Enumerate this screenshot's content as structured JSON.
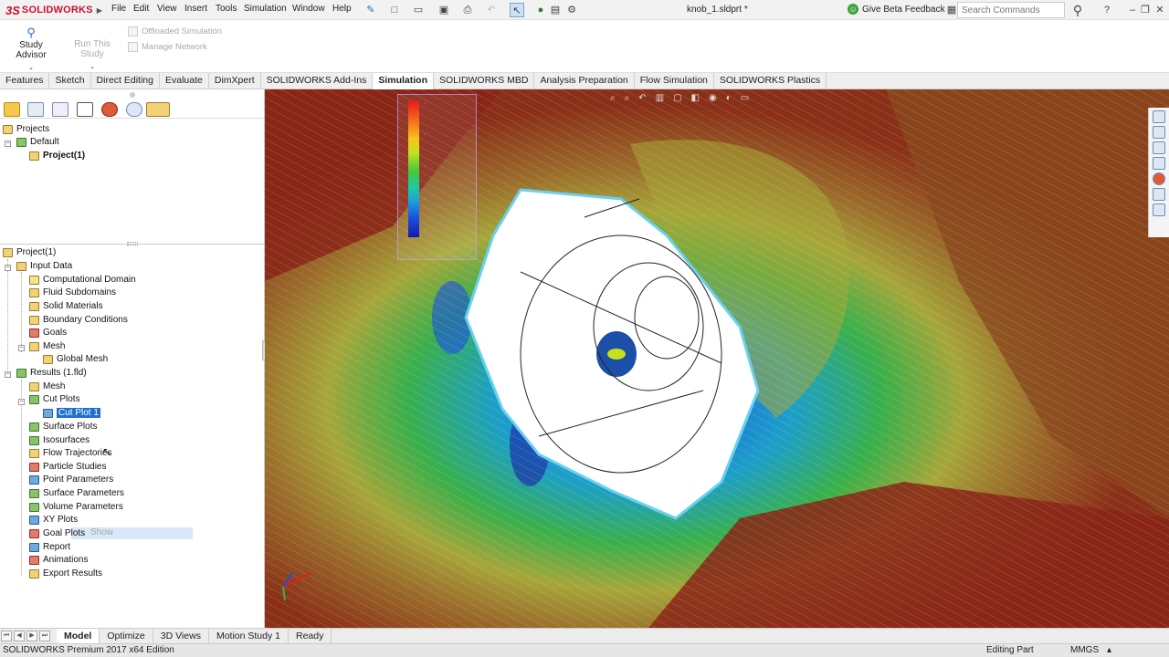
{
  "app": {
    "logo_ds": "3S",
    "logo_text": "SOLIDWORKS",
    "document_title": "knob_1.sldprt *",
    "feedback_label": "Give Beta Feedback",
    "search_placeholder": "Search Commands"
  },
  "menu": [
    "File",
    "Edit",
    "View",
    "Insert",
    "Tools",
    "Simulation",
    "Window",
    "Help"
  ],
  "command_manager": {
    "study_advisor": "Study Advisor",
    "run_this_study": "Run This Study",
    "offloaded_simulation": "Offloaded Simulation",
    "manage_network": "Manage Network",
    "study_advisor_dash": "-",
    "run_dash": "-"
  },
  "tabs": [
    {
      "label": "Features",
      "active": false
    },
    {
      "label": "Sketch",
      "active": false
    },
    {
      "label": "Direct Editing",
      "active": false
    },
    {
      "label": "Evaluate",
      "active": false
    },
    {
      "label": "DimXpert",
      "active": false
    },
    {
      "label": "SOLIDWORKS Add-Ins",
      "active": false
    },
    {
      "label": "Simulation",
      "active": true
    },
    {
      "label": "SOLIDWORKS MBD",
      "active": false
    },
    {
      "label": "Analysis Preparation",
      "active": false
    },
    {
      "label": "Flow Simulation",
      "active": false
    },
    {
      "label": "SOLIDWORKS Plastics",
      "active": false
    }
  ],
  "projects_tree": {
    "root": "Projects",
    "default": "Default",
    "project": "Project(1)"
  },
  "analysis_tree": {
    "root": "Project(1)",
    "input_data": "Input Data",
    "computational_domain": "Computational Domain",
    "fluid_subdomains": "Fluid Subdomains",
    "solid_materials": "Solid Materials",
    "boundary_conditions": "Boundary Conditions",
    "goals": "Goals",
    "mesh": "Mesh",
    "global_mesh": "Global Mesh",
    "results": "Results (1.fld)",
    "results_mesh": "Mesh",
    "cut_plots": "Cut Plots",
    "cut_plot_1": "Cut Plot 1",
    "surface_plots": "Surface Plots",
    "isosurfaces": "Isosurfaces",
    "flow_trajectories": "Flow Trajectories",
    "particle_studies": "Particle Studies",
    "point_parameters": "Point Parameters",
    "surface_parameters": "Surface Parameters",
    "volume_parameters": "Volume Parameters",
    "xy_plots": "XY Plots",
    "goal_plots": "Goal Plots",
    "report": "Report",
    "animations": "Animations",
    "export_results": "Export Results",
    "drag_hint": "Show"
  },
  "bottom_tabs": [
    {
      "label": "Model",
      "active": true
    },
    {
      "label": "Optimize",
      "active": false
    },
    {
      "label": "3D Views",
      "active": false
    },
    {
      "label": "Motion Study 1",
      "active": false
    },
    {
      "label": "Ready",
      "active": false
    }
  ],
  "status": {
    "edition": "SOLIDWORKS Premium 2017 x64 Edition",
    "editing": "Editing Part",
    "units": "MMGS"
  },
  "colors": {
    "brand_red": "#c8102e",
    "selection_blue": "#1f6fd1",
    "plot_hot": "#8a3a1a",
    "plot_mid": "#a8a83a",
    "plot_cold": "#1c4fe2"
  },
  "icons": [
    "search-icon",
    "help-icon",
    "new-doc-icon",
    "open-icon",
    "save-icon",
    "print-icon",
    "undo-icon",
    "select-icon",
    "traffic-light-icon",
    "options-icon",
    "pin-icon"
  ]
}
